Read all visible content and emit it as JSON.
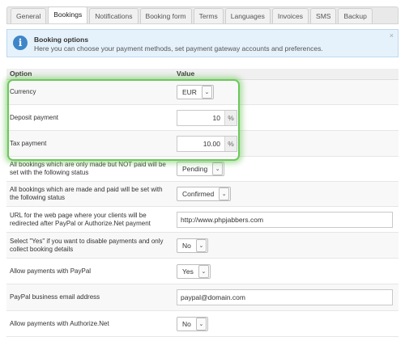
{
  "tabs": [
    {
      "label": "General",
      "active": false
    },
    {
      "label": "Bookings",
      "active": true
    },
    {
      "label": "Notifications",
      "active": false
    },
    {
      "label": "Booking form",
      "active": false
    },
    {
      "label": "Terms",
      "active": false
    },
    {
      "label": "Languages",
      "active": false
    },
    {
      "label": "Invoices",
      "active": false
    },
    {
      "label": "SMS",
      "active": false
    },
    {
      "label": "Backup",
      "active": false
    }
  ],
  "info": {
    "title": "Booking options",
    "text": "Here you can choose your payment methods, set payment gateway accounts and preferences.",
    "close": "×"
  },
  "table": {
    "col_option": "Option",
    "col_value": "Value",
    "rows": [
      {
        "label": "Currency",
        "type": "select",
        "value": "EUR"
      },
      {
        "label": "Deposit payment",
        "type": "number",
        "value": "10",
        "unit": "%"
      },
      {
        "label": "Tax payment",
        "type": "number",
        "value": "10.00",
        "unit": "%"
      },
      {
        "label": "All bookings which are only made but NOT paid will be set with the following status",
        "type": "select",
        "value": "Pending"
      },
      {
        "label": "All bookings which are made and paid will be set with the following status",
        "type": "select",
        "value": "Confirmed"
      },
      {
        "label": "URL for the web page where your clients will be redirected after PayPal or Authorize.Net payment",
        "type": "text",
        "value": "http://www.phpjabbers.com"
      },
      {
        "label": "Select \"Yes\" if you want to disable payments and only collect booking details",
        "type": "select",
        "value": "No"
      },
      {
        "label": "Allow payments with PayPal",
        "type": "select",
        "value": "Yes"
      },
      {
        "label": "PayPal business email address",
        "type": "text",
        "value": "paypal@domain.com"
      },
      {
        "label": "Allow payments with Authorize.Net",
        "type": "select",
        "value": "No"
      }
    ]
  },
  "arrow_glyph": "⌄",
  "colors": {
    "highlight": "#6cc85a",
    "info_bg": "#e6f2fb",
    "info_icon": "#3f86c9"
  }
}
